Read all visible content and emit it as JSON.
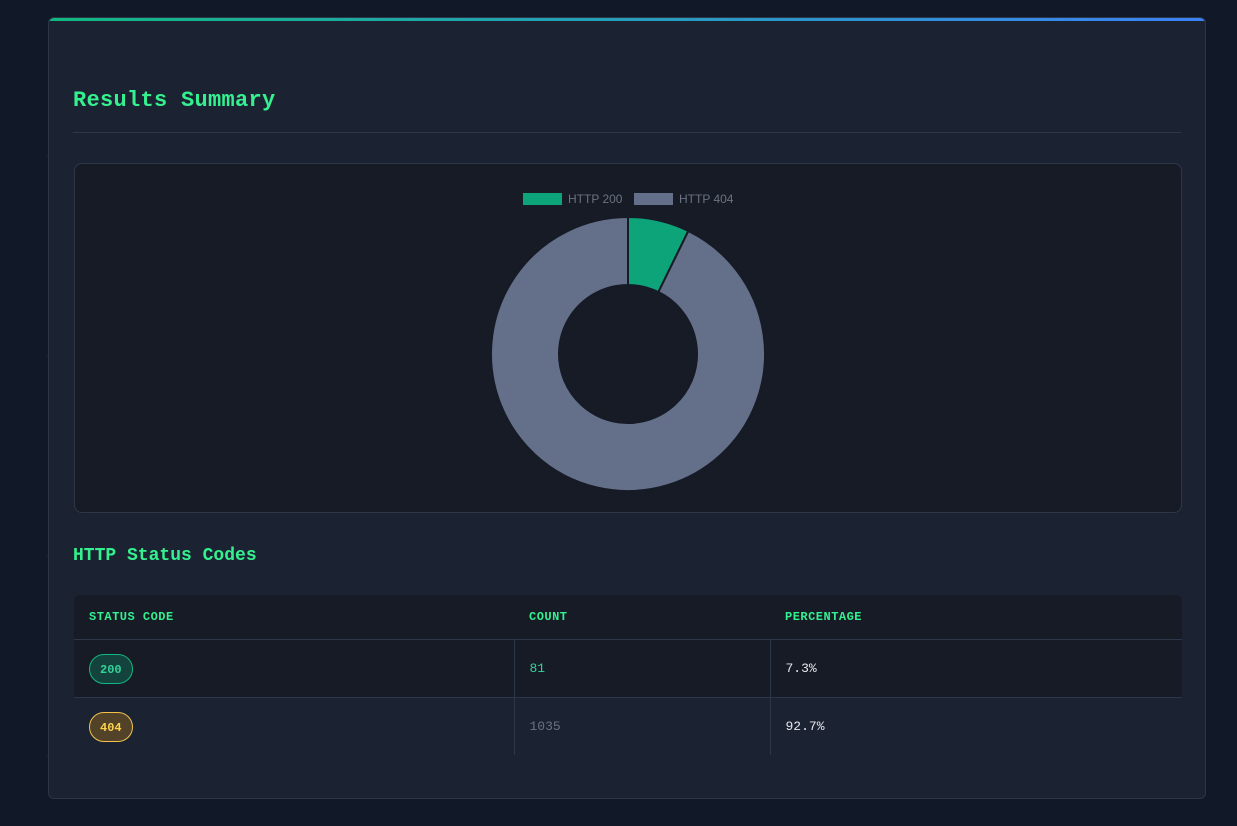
{
  "header": {
    "title": "Results Summary",
    "accent_start": "#10b981",
    "accent_end": "#3b82f6"
  },
  "chart_data": {
    "type": "pie",
    "donut": true,
    "legend_position": "top",
    "categories": [
      "HTTP 200",
      "HTTP 404"
    ],
    "values": [
      81,
      1035
    ],
    "colors": [
      "#0ea47a",
      "#64708a"
    ]
  },
  "status_section": {
    "title": "HTTP Status Codes",
    "columns": [
      "STATUS CODE",
      "COUNT",
      "PERCENTAGE"
    ],
    "rows": [
      {
        "code": "200",
        "count": "81",
        "percentage": "7.3%",
        "badge_color": "#10b981"
      },
      {
        "code": "404",
        "count": "1035",
        "percentage": "92.7%",
        "badge_color": "#f59e0b"
      }
    ]
  }
}
